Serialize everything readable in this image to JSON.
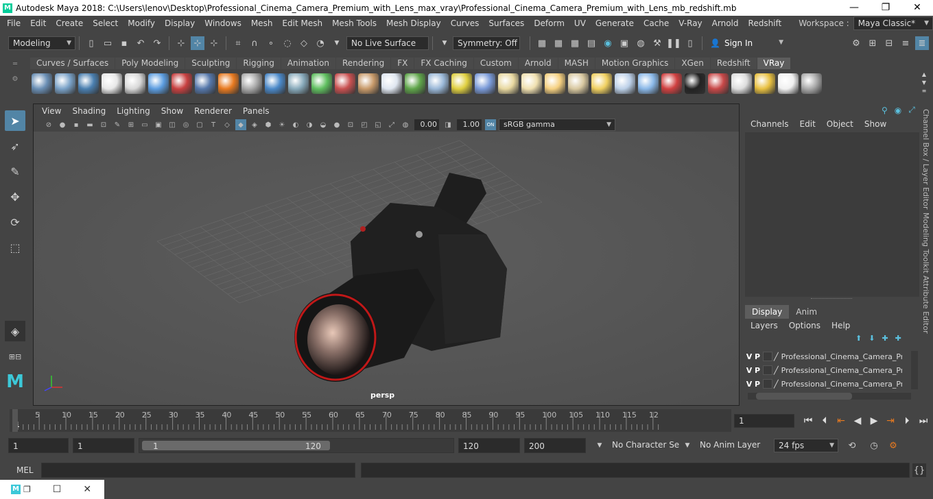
{
  "window": {
    "title": "Autodesk Maya 2018: C:\\Users\\lenov\\Desktop\\Professional_Cinema_Camera_Premium_with_Lens_max_vray\\Professional_Cinema_Camera_Premium_with_Lens_mb_redshift.mb",
    "minimize": "—",
    "maximize": "❐",
    "close": "✕"
  },
  "menubar": {
    "items": [
      "File",
      "Edit",
      "Create",
      "Select",
      "Modify",
      "Display",
      "Windows",
      "Mesh",
      "Edit Mesh",
      "Mesh Tools",
      "Mesh Display",
      "Curves",
      "Surfaces",
      "Deform",
      "UV",
      "Generate",
      "Cache",
      "V-Ray",
      "Arnold",
      "Redshift"
    ],
    "workspace_label": "Workspace :",
    "workspace_value": "Maya Classic*"
  },
  "toolbar": {
    "mode": "Modeling",
    "live_surface": "No Live Surface",
    "symmetry": "Symmetry: Off",
    "sign_in": "Sign In"
  },
  "shelf": {
    "tabs": [
      "Curves / Surfaces",
      "Poly Modeling",
      "Sculpting",
      "Rigging",
      "Animation",
      "Rendering",
      "FX",
      "FX Caching",
      "Custom",
      "Arnold",
      "MASH",
      "Motion Graphics",
      "XGen",
      "Redshift",
      "VRay"
    ],
    "active": "VRay",
    "icon_colors": [
      "#6a8fb5",
      "#7aa2c8",
      "#4a7fb0",
      "#e8e8e8",
      "#d8d8d8",
      "#5c9de0",
      "#c84040",
      "#5577aa",
      "#e87a20",
      "#aaaaaa",
      "#4a88c8",
      "#8ab",
      "#5fbf5f",
      "#c85050",
      "#c89a6a",
      "#dfe6f0",
      "#5fa54a",
      "#9ab8d8",
      "#e0d040",
      "#7a9ad8",
      "#e8d8a0",
      "#f0e0b0",
      "#f5d080",
      "#d8c8a0",
      "#f0d060",
      "#bcd0e8",
      "#8ab8e8",
      "#d04040",
      "#222",
      "#c84848",
      "#dddddd",
      "#e8c040",
      "#f0f0f0",
      "#aaaaaa"
    ]
  },
  "panel": {
    "menu": [
      "View",
      "Shading",
      "Lighting",
      "Show",
      "Renderer",
      "Panels"
    ],
    "exposure": "0.00",
    "gamma": "1.00",
    "color_space": "sRGB gamma",
    "camera_label": "persp"
  },
  "channel_box": {
    "menu": [
      "Channels",
      "Edit",
      "Object",
      "Show"
    ]
  },
  "layer_editor": {
    "tabs": [
      "Display",
      "Anim"
    ],
    "active_tab": "Display",
    "menu": [
      "Layers",
      "Options",
      "Help"
    ],
    "layers": [
      {
        "v": "V",
        "p": "P",
        "name": "Professional_Cinema_Camera_Prem"
      },
      {
        "v": "V",
        "p": "P",
        "name": "Professional_Cinema_Camera_Prem"
      },
      {
        "v": "V",
        "p": "P",
        "name": "Professional_Cinema_Camera_Prem"
      }
    ]
  },
  "side_tabs": [
    "Channel Box / Layer Editor",
    "Modeling Toolkit",
    "Attribute Editor"
  ],
  "timeline": {
    "ticks": [
      "1",
      "5",
      "10",
      "15",
      "20",
      "25",
      "30",
      "35",
      "40",
      "45",
      "50",
      "55",
      "60",
      "65",
      "70",
      "75",
      "80",
      "85",
      "90",
      "95",
      "100",
      "105",
      "110",
      "115",
      "12"
    ],
    "current_frame": "1"
  },
  "range": {
    "start": "1",
    "playback_start": "1",
    "slider_start": "1",
    "slider_end": "120",
    "playback_end": "120",
    "end": "200",
    "character_set": "No Character Set",
    "anim_layer": "No Anim Layer",
    "fps": "24 fps"
  },
  "command": {
    "label": "MEL"
  }
}
